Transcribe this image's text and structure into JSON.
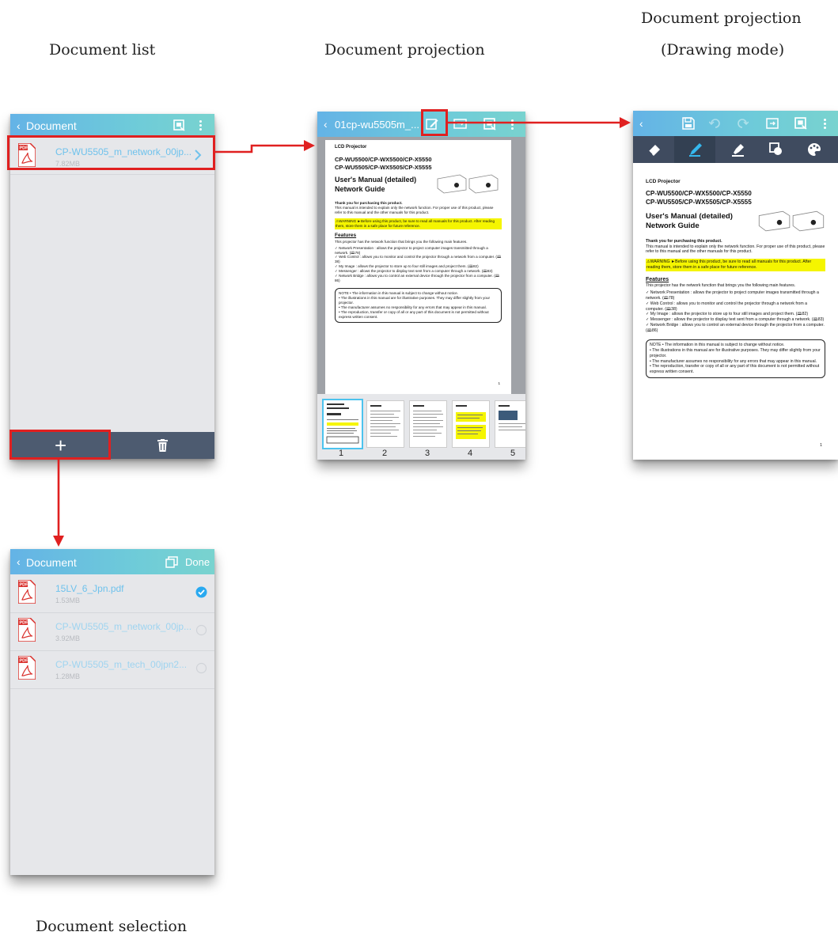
{
  "captions": {
    "doc_list": "Document list",
    "doc_projection": "Document projection",
    "doc_projection_drawing": "Document projection",
    "drawing_mode": "(Drawing mode)",
    "doc_selection": "Document selection"
  },
  "list_screen": {
    "back": "‹",
    "title": "Document",
    "file": {
      "name": "CP-WU5505_m_network_00jp...",
      "size": "7.82MB"
    },
    "bottom_add": "+",
    "icons": [
      "projector-icon",
      "more-vert-icon",
      "chevron-right-icon",
      "trash-icon"
    ]
  },
  "projection_screen": {
    "back": "‹",
    "title": "01cp-wu5505m_...",
    "thumbnails": [
      "1",
      "2",
      "3",
      "4",
      "5"
    ]
  },
  "drawing_screen": {
    "back": "‹",
    "tools": [
      "eraser-icon",
      "pen-icon",
      "highlighter-icon",
      "shape-icon",
      "palette-icon"
    ]
  },
  "selection_screen": {
    "back": "‹",
    "title": "Document",
    "done": "Done",
    "files": [
      {
        "name": "15LV_6_Jpn.pdf",
        "size": "1.53MB",
        "selected": true
      },
      {
        "name": "CP-WU5505_m_network_00jp...",
        "size": "3.92MB",
        "selected": false
      },
      {
        "name": "CP-WU5505_m_tech_00jpn2...",
        "size": "1.28MB",
        "selected": false
      }
    ]
  },
  "document_page": {
    "heading": "LCD Projector",
    "models_1": "CP-WU5500/CP-WX5500/CP-X5550",
    "models_2": "CP-WU5505/CP-WX5505/CP-X5555",
    "manual_1": "User's Manual (detailed)",
    "manual_2": "Network Guide",
    "thanks": "Thank you for purchasing this product.",
    "intro": "This manual is intended to explain only the network function. For proper use of this product, please refer to this manual and the other manuals for this product.",
    "warning": "⚠WARNING ►Before using this product, be sure to read all manuals for this product. After reading them, store them in a safe place for future reference.",
    "features_title": "Features",
    "features_intro": "This projector has the network function that brings you the following main features.",
    "features": [
      "✓ Network Presentation : allows the projector to project computer images transmitted through a network. (🕮78)",
      "✓ Web Control : allows you to monitor and control the projector through a network from a computer. (🕮38)",
      "✓ My Image : allows the projector to store up to four still images and project them. (🕮82)",
      "✓ Messenger : allows the projector to display text sent from a computer through a network. (🕮83)",
      "✓ Network Bridge : allows you to control an external device through the projector from a computer. (🕮86)"
    ],
    "note": [
      "NOTE • The information in this manual is subject to change without notice.",
      "• The illustrations in this manual are for illustrative purposes. They may differ slightly from your projector.",
      "• The manufacturer assumes no responsibility for any errors that may appear in this manual.",
      "• The reproduction, transfer or copy of all or any part of this document is not permitted without express written consent."
    ],
    "page_number": "1"
  },
  "colors": {
    "appbar_gradient": [
      "#64b3e6",
      "#79d3cf"
    ],
    "tool_bar": "#3f4b5f",
    "bottom_bar": "#4d5b70",
    "accent_text": "#6fc2ec",
    "highlight_box": "#e02020",
    "check_blue": "#29a9f0",
    "pdf_red": "#d9302c"
  }
}
